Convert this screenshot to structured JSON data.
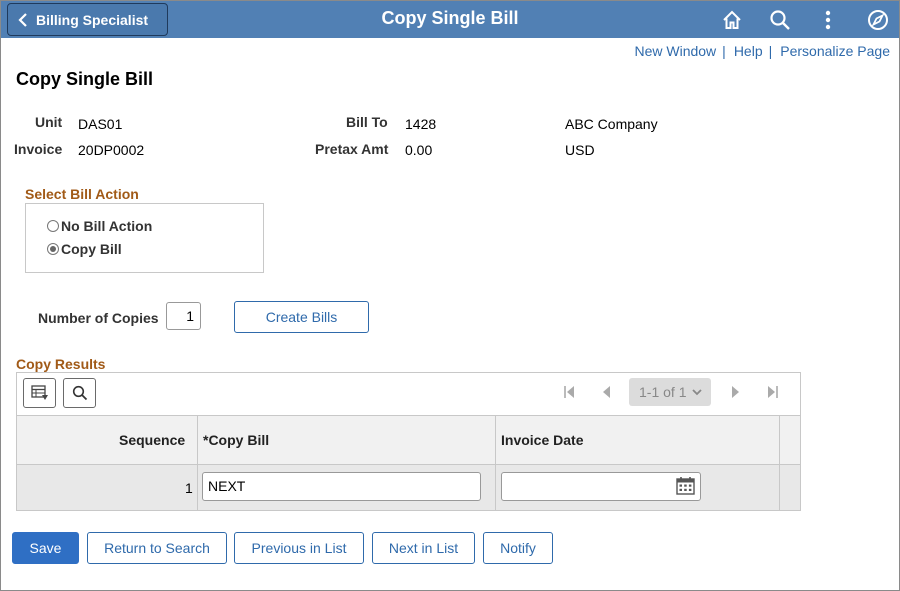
{
  "header": {
    "back_label": "Billing Specialist",
    "title": "Copy Single Bill",
    "icons": [
      "home-icon",
      "search-icon",
      "actions-menu-icon",
      "navbar-icon"
    ],
    "bar_color": "#5180b4"
  },
  "links": {
    "new_window": "New Window",
    "help": "Help",
    "personalize": "Personalize Page",
    "sep": "|"
  },
  "page_title": "Copy Single Bill",
  "info": {
    "unit_label": "Unit",
    "unit_value": "DAS01",
    "invoice_label": "Invoice",
    "invoice_value": "20DP0002",
    "billto_label": "Bill To",
    "billto_value": "1428",
    "customer_name": "ABC Company",
    "pretax_label": "Pretax Amt",
    "pretax_value": "0.00",
    "currency": "USD"
  },
  "bill_action": {
    "title": "Select Bill Action",
    "options": [
      "No Bill Action",
      "Copy Bill"
    ],
    "selected": "Copy Bill"
  },
  "copies": {
    "label": "Number of Copies",
    "value": "1",
    "create_button": "Create Bills"
  },
  "results": {
    "title": "Copy Results",
    "pager_text": "1-1 of 1",
    "columns": [
      "Sequence",
      "*Copy Bill",
      "Invoice Date"
    ],
    "rows": [
      {
        "sequence": "1",
        "copy_bill": "NEXT",
        "invoice_date": ""
      }
    ]
  },
  "footer": {
    "save": "Save",
    "return_to_search": "Return to Search",
    "previous_in_list": "Previous in List",
    "next_in_list": "Next in List",
    "notify": "Notify"
  },
  "colors": {
    "link": "#2f6aab",
    "section_title": "#a15a17",
    "primary_button": "#2f6fc4"
  }
}
